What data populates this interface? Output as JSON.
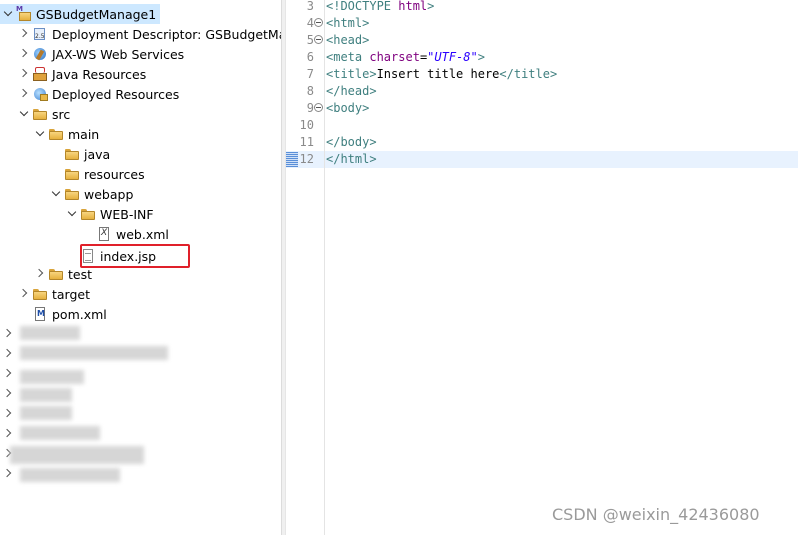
{
  "explorer": {
    "project": "GSBudgetManage1",
    "items": {
      "deploy": "Deployment Descriptor: GSBudgetMar",
      "ws": "JAX-WS Web Services",
      "jres": "Java Resources",
      "dres": "Deployed Resources",
      "src": "src",
      "main": "main",
      "java": "java",
      "resources": "resources",
      "webapp": "webapp",
      "webinf": "WEB-INF",
      "webxml": "web.xml",
      "indexjsp": "index.jsp",
      "test": "test",
      "target": "target",
      "pom": "pom.xml"
    }
  },
  "editor": {
    "lines": {
      "l3": {
        "n": "3",
        "a": "<!DOCTYPE ",
        "b": "html",
        "c": ">"
      },
      "l4": {
        "n": "4",
        "a": "<html>"
      },
      "l5": {
        "n": "5",
        "a": "<head>"
      },
      "l6": {
        "n": "6",
        "a": "<meta ",
        "b": "charset",
        "c": "=",
        "d": "\"UTF-8\"",
        "e": ">"
      },
      "l7": {
        "n": "7",
        "a": "<title>",
        "b": "Insert title here",
        "c": "</title>"
      },
      "l8": {
        "n": "8",
        "a": "</head>"
      },
      "l9": {
        "n": "9",
        "a": "<body>"
      },
      "l10": {
        "n": "10"
      },
      "l11": {
        "n": "11",
        "a": "</body>"
      },
      "l12": {
        "n": "12",
        "a": "</html>"
      }
    }
  },
  "watermark": "CSDN @weixin_42436080",
  "colors": {
    "selection": "#cde8ff",
    "highlight_box": "#e0202a",
    "tag": "#3f7f7f",
    "attribute": "#7f007f",
    "value": "#2a00ff"
  }
}
